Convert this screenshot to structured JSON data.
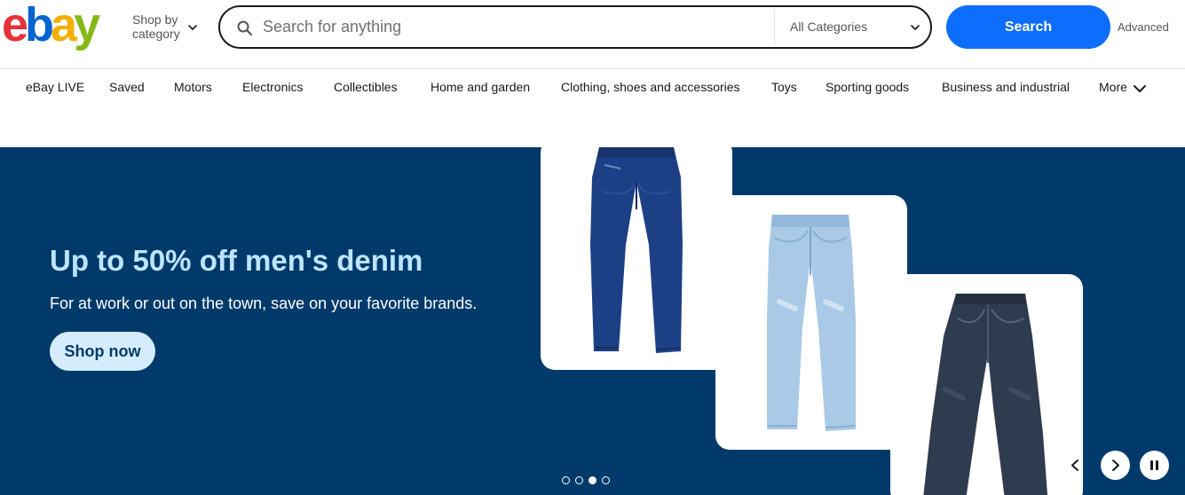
{
  "brand": {
    "logo_letters": [
      "e",
      "b",
      "a",
      "y"
    ],
    "logo_colors": [
      "#e53238",
      "#0064d2",
      "#f5af02",
      "#86b817"
    ]
  },
  "header": {
    "shop_by_line1": "Shop by",
    "shop_by_line2": "category",
    "search_placeholder": "Search for anything",
    "category_selected": "All Categories",
    "search_button": "Search",
    "advanced_link": "Advanced"
  },
  "nav": {
    "items": [
      "eBay LIVE",
      "Saved",
      "Motors",
      "Electronics",
      "Collectibles",
      "Home and garden",
      "Clothing, shoes and accessories",
      "Toys",
      "Sporting goods",
      "Business and industrial",
      "More"
    ]
  },
  "hero": {
    "title": "Up to 50% off men's denim",
    "subtitle": "For at work or out on the town, save on your favorite brands.",
    "cta": "Shop now",
    "slide_count": 4,
    "active_slide": 3,
    "background_color": "#003a6b"
  },
  "icons": {
    "search": "search-icon",
    "chevron": "chevron-down-icon",
    "prev": "chevron-left-icon",
    "next": "chevron-right-icon",
    "pause": "pause-icon"
  }
}
